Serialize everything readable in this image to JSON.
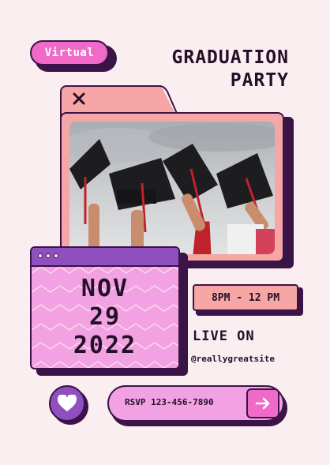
{
  "badge": {
    "label": "Virtual"
  },
  "title": {
    "line1": "GRADUATION",
    "line2": "PARTY"
  },
  "folder": {
    "close_icon": "close-icon",
    "photo": "graduation-caps-photo"
  },
  "date": {
    "month": "NOV",
    "day": "29",
    "year": "2022"
  },
  "time": {
    "label": "8PM - 12 PM"
  },
  "live": {
    "heading": "LIVE ON",
    "handle": "@reallygreatsite"
  },
  "rsvp": {
    "label": "RSVP 123-456-7890",
    "icon": "arrow-right-icon"
  },
  "like": {
    "icon": "heart-icon"
  },
  "colors": {
    "background": "#fbeef1",
    "dark": "#3b1447",
    "pink": "#f06bc7",
    "light_pink": "#f2a2e2",
    "salmon": "#f6a6a5",
    "purple": "#8f4fbf"
  }
}
